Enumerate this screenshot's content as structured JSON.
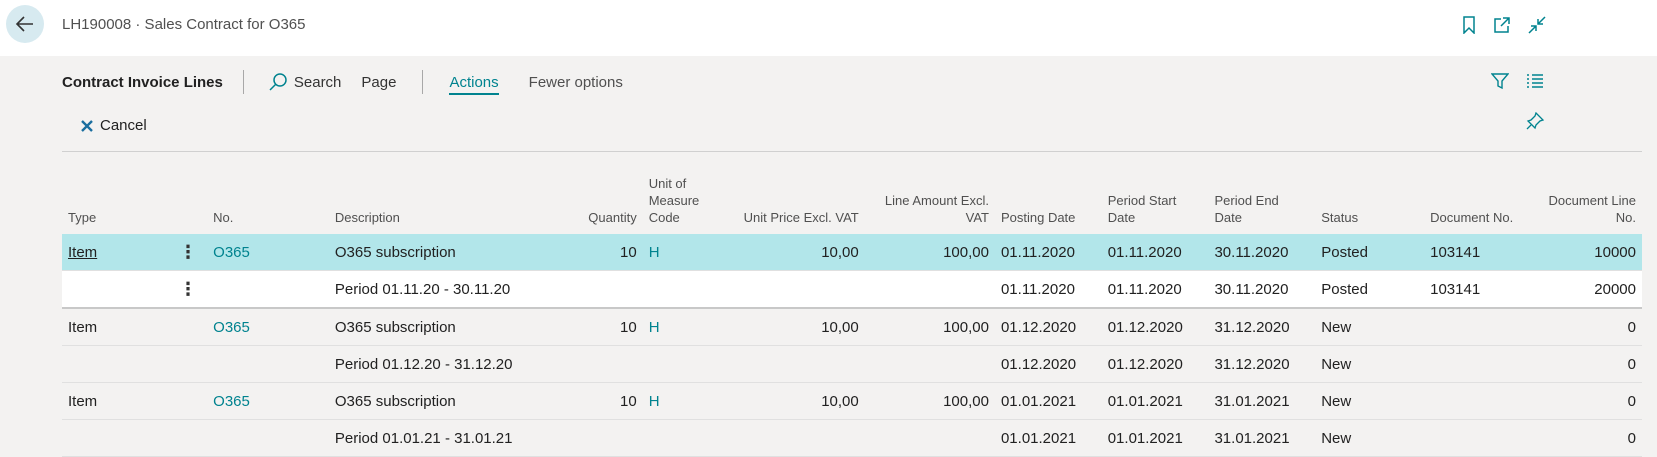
{
  "header": {
    "title": "LH190008 · Sales Contract for O365"
  },
  "actionbar": {
    "title": "Contract Invoice Lines",
    "search_label": "Search",
    "page_label": "Page",
    "actions_label": "Actions",
    "fewer_label": "Fewer options"
  },
  "toolbar": {
    "cancel_label": "Cancel"
  },
  "columns": [
    "Type",
    "",
    "No.",
    "Description",
    "Quantity",
    "Unit of Measure Code",
    "Unit Price Excl. VAT",
    "Line Amount Excl. VAT",
    "Posting Date",
    "Period Start Date",
    "Period End Date",
    "Status",
    "Document No.",
    "Document Line No."
  ],
  "rows": [
    {
      "type": "Item",
      "no": "O365",
      "description": "O365 subscription",
      "quantity": "10",
      "uom": "H",
      "unit_price": "10,00",
      "line_amount": "100,00",
      "posting_date": "01.11.2020",
      "period_start": "01.11.2020",
      "period_end": "30.11.2020",
      "status": "Posted",
      "document_no": "103141",
      "document_line_no": "10000"
    },
    {
      "type": "",
      "no": "",
      "description": "Period 01.11.20 - 30.11.20",
      "quantity": "",
      "uom": "",
      "unit_price": "",
      "line_amount": "",
      "posting_date": "01.11.2020",
      "period_start": "01.11.2020",
      "period_end": "30.11.2020",
      "status": "Posted",
      "document_no": "103141",
      "document_line_no": "20000"
    },
    {
      "type": "Item",
      "no": "O365",
      "description": "O365 subscription",
      "quantity": "10",
      "uom": "H",
      "unit_price": "10,00",
      "line_amount": "100,00",
      "posting_date": "01.12.2020",
      "period_start": "01.12.2020",
      "period_end": "31.12.2020",
      "status": "New",
      "document_no": "",
      "document_line_no": "0"
    },
    {
      "type": "",
      "no": "",
      "description": "Period 01.12.20 - 31.12.20",
      "quantity": "",
      "uom": "",
      "unit_price": "",
      "line_amount": "",
      "posting_date": "01.12.2020",
      "period_start": "01.12.2020",
      "period_end": "31.12.2020",
      "status": "New",
      "document_no": "",
      "document_line_no": "0"
    },
    {
      "type": "Item",
      "no": "O365",
      "description": "O365 subscription",
      "quantity": "10",
      "uom": "H",
      "unit_price": "10,00",
      "line_amount": "100,00",
      "posting_date": "01.01.2021",
      "period_start": "01.01.2021",
      "period_end": "31.01.2021",
      "status": "New",
      "document_no": "",
      "document_line_no": "0"
    },
    {
      "type": "",
      "no": "",
      "description": "Period 01.01.21 - 31.01.21",
      "quantity": "",
      "uom": "",
      "unit_price": "",
      "line_amount": "",
      "posting_date": "01.01.2021",
      "period_start": "01.01.2021",
      "period_end": "31.01.2021",
      "status": "New",
      "document_no": "",
      "document_line_no": "0"
    }
  ],
  "icons": {
    "back": "back-arrow-icon",
    "bookmark": "bookmark-icon",
    "popout": "open-new-window-icon",
    "collapse": "collapse-icon",
    "search": "search-icon",
    "cancel": "cancel-x-icon",
    "filter": "filter-icon",
    "list": "list-view-icon",
    "pin": "pin-icon",
    "row_menu": "more-vertical-icon"
  },
  "colors": {
    "accent": "#00838f",
    "selected_row": "#b2e6ea",
    "cancel_icon": "#1a6e9f"
  }
}
